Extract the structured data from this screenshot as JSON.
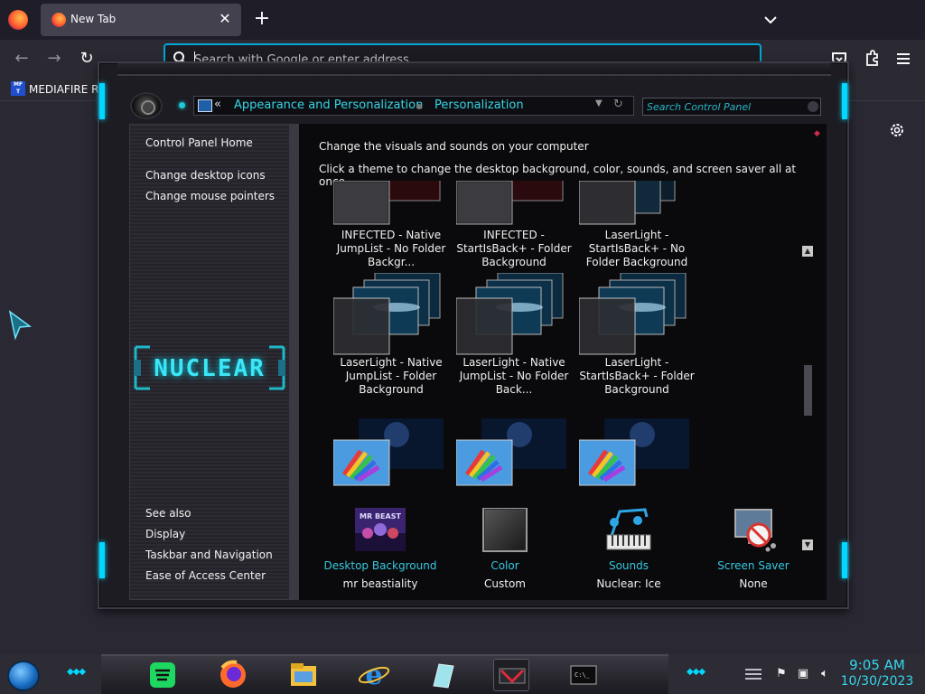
{
  "browser": {
    "tab": {
      "title": "New Tab",
      "close": "✕"
    },
    "new_tab": "+",
    "nav": {
      "back": "←",
      "forward": "→",
      "reload": "↻"
    },
    "urlbar": {
      "placeholder": "Search with Google or enter address",
      "value": ""
    },
    "bookmarks": [
      {
        "icon_text": "MF T",
        "label": "MEDIAFIRE RO"
      }
    ]
  },
  "control_panel": {
    "breadcrumb": {
      "back": "«",
      "items": [
        "Appearance and Personalization",
        "Personalization"
      ]
    },
    "search_placeholder": "Search Control Panel",
    "left_nav": {
      "links": [
        "Control Panel Home",
        "Change desktop icons",
        "Change mouse pointers"
      ],
      "logo": "NUCLEAR",
      "see_also_heading": "See also",
      "see_also": [
        "Display",
        "Taskbar and Navigation",
        "Ease of Access Center"
      ]
    },
    "heading": "Change the visuals and sounds on your computer",
    "subheading": "Click a theme to change the desktop background, color, sounds, and screen saver all at once.",
    "themes": [
      {
        "name": "INFECTED - Native\nJumpList - No Folder\nBackgr..."
      },
      {
        "name": "INFECTED -\nStartIsBack+ - Folder\nBackground"
      },
      {
        "name": "LaserLight -\nStartIsBack+ - No\nFolder Background"
      },
      {
        "name": "LaserLight - Native\nJumpList - Folder\nBackground"
      },
      {
        "name": "LaserLight - Native\nJumpList - No Folder\nBack..."
      },
      {
        "name": "LaserLight -\nStartIsBack+ - Folder\nBackground"
      },
      {
        "name": ""
      },
      {
        "name": ""
      },
      {
        "name": ""
      }
    ],
    "bottom": [
      {
        "label": "Desktop Background",
        "value": "mr beastiality",
        "icon": "wallpaper-icon"
      },
      {
        "label": "Color",
        "value": "Custom",
        "icon": "color-swatch-icon"
      },
      {
        "label": "Sounds",
        "value": "Nuclear: Ice",
        "icon": "music-notes-icon"
      },
      {
        "label": "Screen Saver",
        "value": "None",
        "icon": "screen-saver-icon"
      }
    ]
  },
  "taskbar": {
    "apps": [
      "spotify-icon",
      "firefox-icon",
      "file-explorer-icon",
      "internet-explorer-icon",
      "glass-app-icon",
      "control-panel-icon",
      "command-prompt-icon"
    ],
    "clock": {
      "time": "9:05 AM",
      "date": "10/30/2023"
    }
  },
  "colors": {
    "accent": "#36d6e6",
    "link": "#36c8e0",
    "focus": "#00a8d8"
  }
}
